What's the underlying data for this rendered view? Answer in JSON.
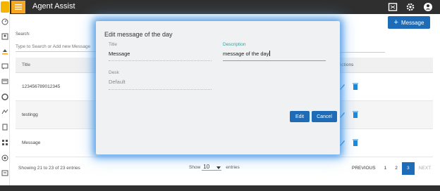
{
  "header": {
    "app_title": "Agent Assist"
  },
  "toolbar": {
    "new_message_label": "Message"
  },
  "search": {
    "label": "Search:",
    "placeholder": "Type to Search or Add new Message"
  },
  "table": {
    "columns": {
      "title": "Title",
      "actions": "Actions"
    },
    "rows": [
      {
        "title": "123456789012345"
      },
      {
        "title": "testingg"
      },
      {
        "title": "Message"
      }
    ]
  },
  "footer": {
    "info": "Showing 21 to 23 of 23 entries",
    "show_label": "Show",
    "page_size": "10",
    "entries_label": "entries",
    "pager": {
      "previous": "PREVIOUS",
      "pages": [
        "1",
        "2",
        "3"
      ],
      "current": "3",
      "next": "NEXT"
    }
  },
  "modal": {
    "title": "Edit message of the day",
    "fields": {
      "title": {
        "label": "Title",
        "value": "Message"
      },
      "description": {
        "label": "Description",
        "value": "message of the day"
      },
      "desk": {
        "label": "Desk",
        "value": "Default"
      }
    },
    "edit_label": "Edit",
    "cancel_label": "Cancel"
  },
  "colors": {
    "brand": "#f5a623",
    "primary": "#1e6bb8",
    "topbar": "#2f2f2f",
    "focus": "#2aa6a0"
  }
}
